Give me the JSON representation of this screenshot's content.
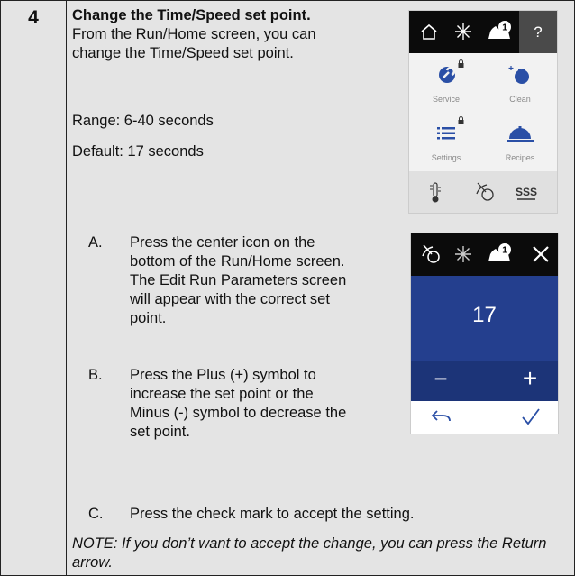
{
  "step": {
    "number": "4"
  },
  "intro": {
    "heading": "Change the Time/Speed set point.",
    "body": " From the Run/Home screen, you can change the Time/Speed set point.",
    "range": "Range: 6-40 seconds",
    "default": "Default: 17 seconds"
  },
  "steps": [
    {
      "letter": "A.",
      "text": "Press the center icon on the bottom of the Run/Home screen. The Edit Run Parameters screen will appear with the correct set point."
    },
    {
      "letter": "B.",
      "text": "Press the Plus (+) symbol to increase the set point or the Minus (-) symbol to decrease the set point."
    },
    {
      "letter": "C.",
      "text": "Press the check mark to accept the setting."
    }
  ],
  "note": "NOTE: If you don’t want to accept the change, you can press the Return arrow.",
  "home_screen": {
    "help_label": "?",
    "badge": "1",
    "tiles": [
      {
        "label": "Service",
        "icon": "wrench-icon",
        "locked": true
      },
      {
        "label": "Clean",
        "icon": "clean-hand-icon",
        "locked": false
      },
      {
        "label": "Settings",
        "icon": "list-icon",
        "locked": true
      },
      {
        "label": "Recipes",
        "icon": "cloche-icon",
        "locked": false
      }
    ],
    "bottom_icons": [
      "thermometer-icon",
      "speed-dial-icon",
      "heat-icon"
    ],
    "heat_label": "SSS"
  },
  "edit_screen": {
    "badge": "1",
    "value": "17",
    "minus_label": "−",
    "plus_label": "+"
  },
  "colors": {
    "accent_blue": "#243f8e",
    "dark_blue": "#1c3478",
    "icon_blue": "#2a4fa6",
    "panel_gray": "#e4e4e4"
  }
}
